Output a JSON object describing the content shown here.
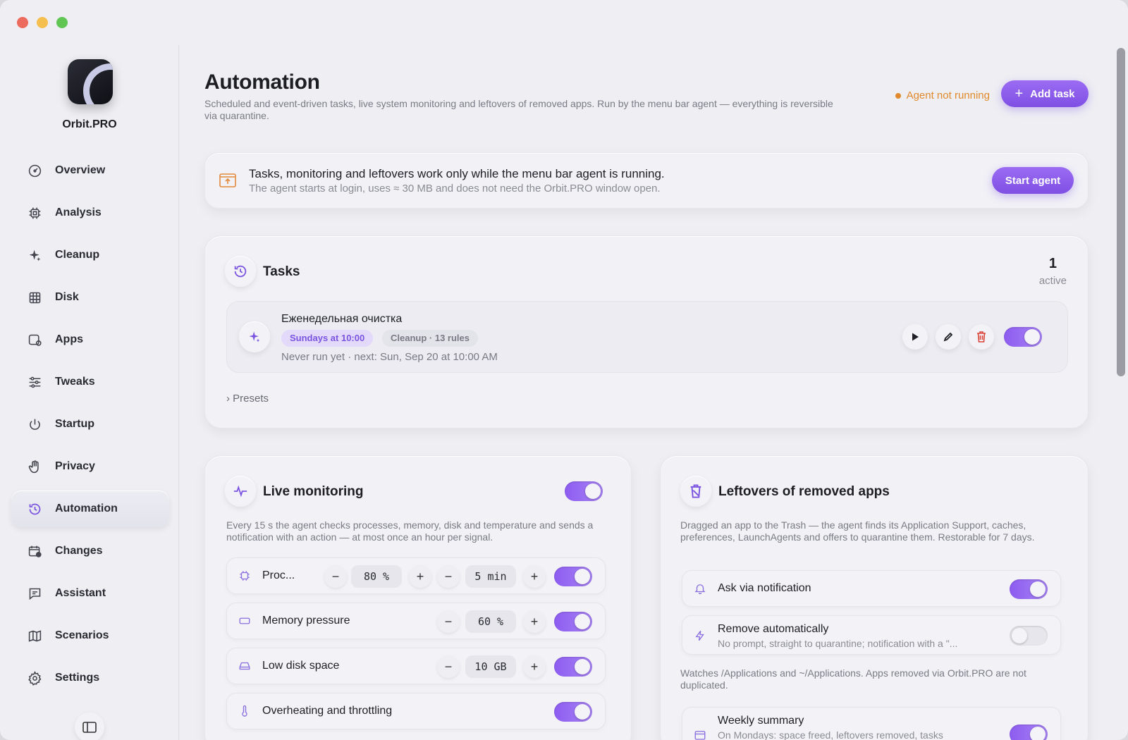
{
  "app": {
    "name": "Orbit.PRO"
  },
  "sidebar": {
    "items": [
      {
        "label": "Overview",
        "icon": "dashboard-icon"
      },
      {
        "label": "Analysis",
        "icon": "chip-icon"
      },
      {
        "label": "Cleanup",
        "icon": "sparkles-icon"
      },
      {
        "label": "Disk",
        "icon": "grid-icon"
      },
      {
        "label": "Apps",
        "icon": "apps-icon"
      },
      {
        "label": "Tweaks",
        "icon": "sliders-icon"
      },
      {
        "label": "Startup",
        "icon": "power-icon"
      },
      {
        "label": "Privacy",
        "icon": "hand-icon"
      },
      {
        "label": "Automation",
        "icon": "history-icon",
        "active": true
      },
      {
        "label": "Changes",
        "icon": "calendar-icon"
      },
      {
        "label": "Assistant",
        "icon": "chat-icon"
      },
      {
        "label": "Scenarios",
        "icon": "map-icon"
      },
      {
        "label": "Settings",
        "icon": "gear-icon"
      }
    ]
  },
  "header": {
    "title": "Automation",
    "subtitle": "Scheduled and event-driven tasks, live system monitoring and leftovers of removed apps. Run by the menu bar agent — everything is reversible via quarantine.",
    "agent_status": "Agent not running",
    "add_task": "Add task"
  },
  "banner": {
    "title": "Tasks, monitoring and leftovers work only while the menu bar agent is running.",
    "subtitle": "The agent starts at login, uses ≈ 30 MB and does not need the Orbit.PRO window open.",
    "button": "Start agent"
  },
  "tasks": {
    "title": "Tasks",
    "count": "1",
    "count_label": "active",
    "items": [
      {
        "name": "Еженедельная очистка",
        "schedule": "Sundays at 10:00",
        "type": "Cleanup · 13 rules",
        "meta": "Never run yet  · next: Sun, Sep 20 at 10:00 AM",
        "enabled": true
      }
    ],
    "presets": "Presets"
  },
  "monitoring": {
    "title": "Live monitoring",
    "enabled": true,
    "description": "Every 15 s the agent checks processes, memory, disk and temperature and sends a notification with an action — at most once an hour per signal.",
    "rows": [
      {
        "label": "Proc...",
        "value1": "80 %",
        "value2": "5 min",
        "enabled": true
      },
      {
        "label": "Memory pressure",
        "value": "60 %",
        "enabled": true
      },
      {
        "label": "Low disk space",
        "value": "10 GB",
        "enabled": true
      },
      {
        "label": "Overheating and throttling",
        "enabled": true
      }
    ]
  },
  "leftovers": {
    "title": "Leftovers of removed apps",
    "description": "Dragged an app to the Trash — the agent finds its Application Support, caches, preferences, LaunchAgents and offers to quarantine them. Restorable for 7 days.",
    "ask": {
      "label": "Ask via notification",
      "enabled": true
    },
    "auto": {
      "label": "Remove automatically",
      "sub": "No prompt, straight to quarantine; notification with a \"...",
      "enabled": false
    },
    "note": "Watches /Applications and ~/Applications. Apps removed via Orbit.PRO are not duplicated.",
    "weekly": {
      "label": "Weekly summary",
      "sub": "On Mondays: space freed, leftovers removed, tasks",
      "enabled": true
    }
  },
  "colors": {
    "accent": "#8d5cf0",
    "warning": "#e08a2c",
    "danger": "#d9433a"
  }
}
